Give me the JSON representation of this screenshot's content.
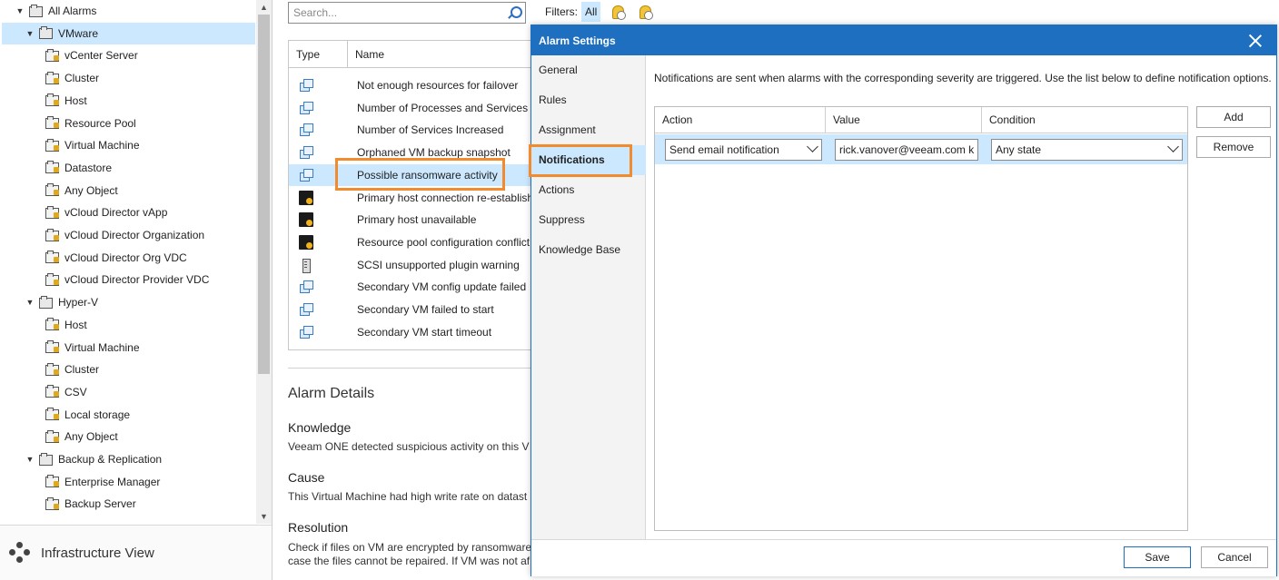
{
  "tree": {
    "items": [
      {
        "label": "All Alarms",
        "level": 0,
        "expanded": true,
        "selected": false
      },
      {
        "label": "VMware",
        "level": 1,
        "expanded": true,
        "selected": true
      },
      {
        "label": "vCenter Server",
        "level": 2
      },
      {
        "label": "Cluster",
        "level": 2
      },
      {
        "label": "Host",
        "level": 2
      },
      {
        "label": "Resource Pool",
        "level": 2
      },
      {
        "label": "Virtual Machine",
        "level": 2
      },
      {
        "label": "Datastore",
        "level": 2
      },
      {
        "label": "Any Object",
        "level": 2
      },
      {
        "label": "vCloud Director vApp",
        "level": 2
      },
      {
        "label": "vCloud Director Organization",
        "level": 2
      },
      {
        "label": "vCloud Director Org VDC",
        "level": 2
      },
      {
        "label": "vCloud Director Provider VDC",
        "level": 2
      },
      {
        "label": "Hyper-V",
        "level": 1,
        "expanded": true
      },
      {
        "label": "Host",
        "level": 2
      },
      {
        "label": "Virtual Machine",
        "level": 2
      },
      {
        "label": "Cluster",
        "level": 2
      },
      {
        "label": "CSV",
        "level": 2
      },
      {
        "label": "Local storage",
        "level": 2
      },
      {
        "label": "Any Object",
        "level": 2
      },
      {
        "label": "Backup & Replication",
        "level": 1,
        "expanded": true
      },
      {
        "label": "Enterprise Manager",
        "level": 2
      },
      {
        "label": "Backup Server",
        "level": 2
      }
    ]
  },
  "bottom_nav": {
    "label": "Infrastructure View"
  },
  "search": {
    "placeholder": "Search..."
  },
  "filters": {
    "label": "Filters:",
    "all_label": "All"
  },
  "alarm_grid": {
    "columns": [
      "Type",
      "Name"
    ],
    "rows": [
      {
        "icon": "vm",
        "name": "Not enough resources for failover"
      },
      {
        "icon": "vm",
        "name": "Number of Processes and Services Increased"
      },
      {
        "icon": "vm",
        "name": "Number of Services Increased"
      },
      {
        "icon": "vm",
        "name": "Orphaned VM backup snapshot"
      },
      {
        "icon": "vm",
        "name": "Possible ransomware activity",
        "selected": true
      },
      {
        "icon": "host",
        "name": "Primary host connection re-establish"
      },
      {
        "icon": "host",
        "name": "Primary host unavailable"
      },
      {
        "icon": "host",
        "name": "Resource pool configuration conflict"
      },
      {
        "icon": "scsi",
        "name": "SCSI unsupported plugin warning"
      },
      {
        "icon": "vm",
        "name": "Secondary VM config update failed"
      },
      {
        "icon": "vm",
        "name": "Secondary VM failed to start"
      },
      {
        "icon": "vm",
        "name": "Secondary VM start timeout"
      }
    ]
  },
  "details": {
    "title": "Alarm Details",
    "knowledge_heading": "Knowledge",
    "knowledge_text": "Veeam ONE detected suspicious activity on this V",
    "cause_heading": "Cause",
    "cause_text": "This Virtual Machine had high write rate on datast",
    "resolution_heading": "Resolution",
    "resolution_text_1": "Check if files on VM are encrypted by ransomware",
    "resolution_text_2": "case the files cannot be repaired. If VM was not af"
  },
  "dialog": {
    "title": "Alarm Settings",
    "nav": [
      "General",
      "Rules",
      "Assignment",
      "Notifications",
      "Actions",
      "Suppress",
      "Knowledge Base"
    ],
    "selected_nav": "Notifications",
    "description": "Notifications are sent when alarms with the corresponding severity are triggered. Use the list below to define notification options.",
    "table": {
      "columns": [
        "Action",
        "Value",
        "Condition"
      ],
      "row": {
        "action": "Send email notification",
        "value": "rick.vanover@veeam.com k",
        "condition": "Any state"
      }
    },
    "add_label": "Add",
    "remove_label": "Remove",
    "save_label": "Save",
    "cancel_label": "Cancel"
  },
  "colors": {
    "accent": "#1e6fc0",
    "selection": "#cce8ff",
    "highlight_box": "#f28a2e"
  }
}
